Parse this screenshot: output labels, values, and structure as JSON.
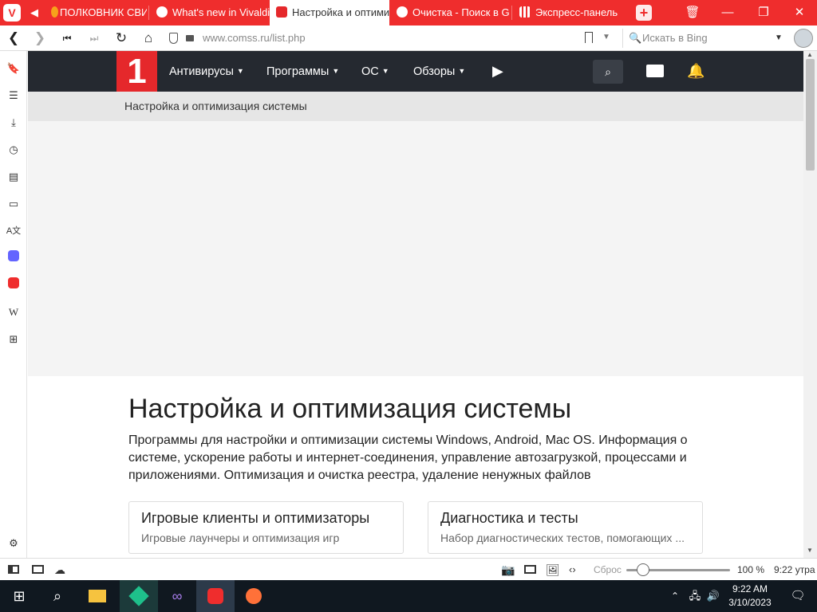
{
  "browser": {
    "tabs": [
      {
        "label": "ПОЛКОВНИК СВИТ",
        "icon": "fire-icon"
      },
      {
        "label": "What's new in Vivaldi",
        "icon": "vivaldi-icon"
      },
      {
        "label": "Настройка и оптимиз",
        "icon": "comss-icon",
        "active": true
      },
      {
        "label": "Очистка - Поиск в Go",
        "icon": "google-icon"
      },
      {
        "label": "Экспресс-панель",
        "icon": "grid-icon"
      }
    ],
    "url": "www.comss.ru/list.php",
    "search_placeholder": "Искать в Bing",
    "side_icons": [
      "bookmark-icon",
      "reading-list-icon",
      "download-icon",
      "history-icon",
      "notes-icon",
      "window-icon",
      "translate-icon",
      "mastodon-icon",
      "vivaldi-icon",
      "wikipedia-icon",
      "add-panel-icon",
      "settings-icon"
    ]
  },
  "site": {
    "logo_text": "1",
    "menu": [
      "Антивирусы",
      "Программы",
      "ОС",
      "Обзоры"
    ],
    "breadcrumb": "Настройка и оптимизация системы",
    "title": "Настройка и оптимизация системы",
    "description": "Программы для настройки и оптимизации системы Windows, Android, Mac OS. Информация о системе, ускорение работы и интернет-соединения, управление автозагрузкой, процессами и приложениями. Оптимизация и очистка реестра, удаление ненужных файлов",
    "cards": [
      {
        "title": "Игровые клиенты и оптимизаторы",
        "subtitle": "Игровые лаунчеры и оптимизация игр"
      },
      {
        "title": "Диагностика и тесты",
        "subtitle": "Набор диагностических тестов, помогающих ..."
      }
    ]
  },
  "statusbar": {
    "reset_label": "Сброс",
    "zoom_level": "100 %",
    "zoom_fraction": 0.5,
    "time": "9:22 утра"
  },
  "taskbar": {
    "time": "9:22 AM",
    "date": "3/10/2023"
  },
  "colors": {
    "vivaldi_red": "#ef2d2d",
    "site_header": "#252930",
    "site_logo": "#e5282b"
  }
}
